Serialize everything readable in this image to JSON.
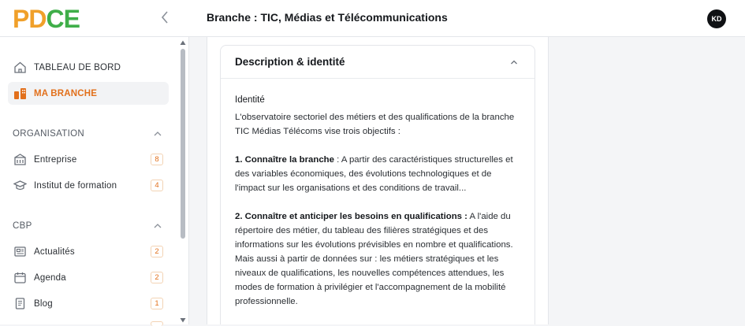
{
  "header": {
    "logo_letters": [
      "P",
      "D",
      "C",
      "E"
    ],
    "page_title": "Branche : TIC, Médias et Télécommunications",
    "avatar_initials": "KD"
  },
  "colors": {
    "accent": "#e2701c",
    "logo_orange": "#f0a02a",
    "logo_green": "#3fae49"
  },
  "sidebar": {
    "top_items": [
      {
        "label": "TABLEAU DE BORD",
        "icon": "home-icon",
        "active": false
      },
      {
        "label": "MA BRANCHE",
        "icon": "branch-icon",
        "active": true
      }
    ],
    "sections": [
      {
        "title": "ORGANISATION",
        "items": [
          {
            "label": "Entreprise",
            "icon": "building-icon",
            "count": "8"
          },
          {
            "label": "Institut de formation",
            "icon": "graduation-cap-icon",
            "count": "4"
          }
        ]
      },
      {
        "title": "CBP",
        "items": [
          {
            "label": "Actualités",
            "icon": "newspaper-icon",
            "count": "2"
          },
          {
            "label": "Agenda",
            "icon": "calendar-icon",
            "count": "2"
          },
          {
            "label": "Blog",
            "icon": "document-icon",
            "count": "1"
          }
        ]
      }
    ]
  },
  "card": {
    "title": "Description & identité",
    "subtitle": "Identité",
    "intro": "L'observatoire sectoriel des métiers et des qualifications de la branche TIC Médias Télécoms vise trois objectifs :",
    "point1_bold": "1. Connaître la branche",
    "point1_text": " : A partir des caractéristiques structurelles et des variables économiques, des évolutions technologiques et de l'impact sur les organisations et des conditions de travail...",
    "point2_bold": "2. Connaître et anticiper les besoins en qualifications :",
    "point2_text": " A l'aide du répertoire des métier, du tableau des filières stratégiques et des informations sur les évolutions prévisibles en nombre et qualifications. Mais aussi à partir de données sur : les métiers stratégiques et les niveaux de qualifications, les nouvelles compétences attendues, les modes de formation à privilégier et l'accompagnement de la mobilité professionnelle."
  }
}
